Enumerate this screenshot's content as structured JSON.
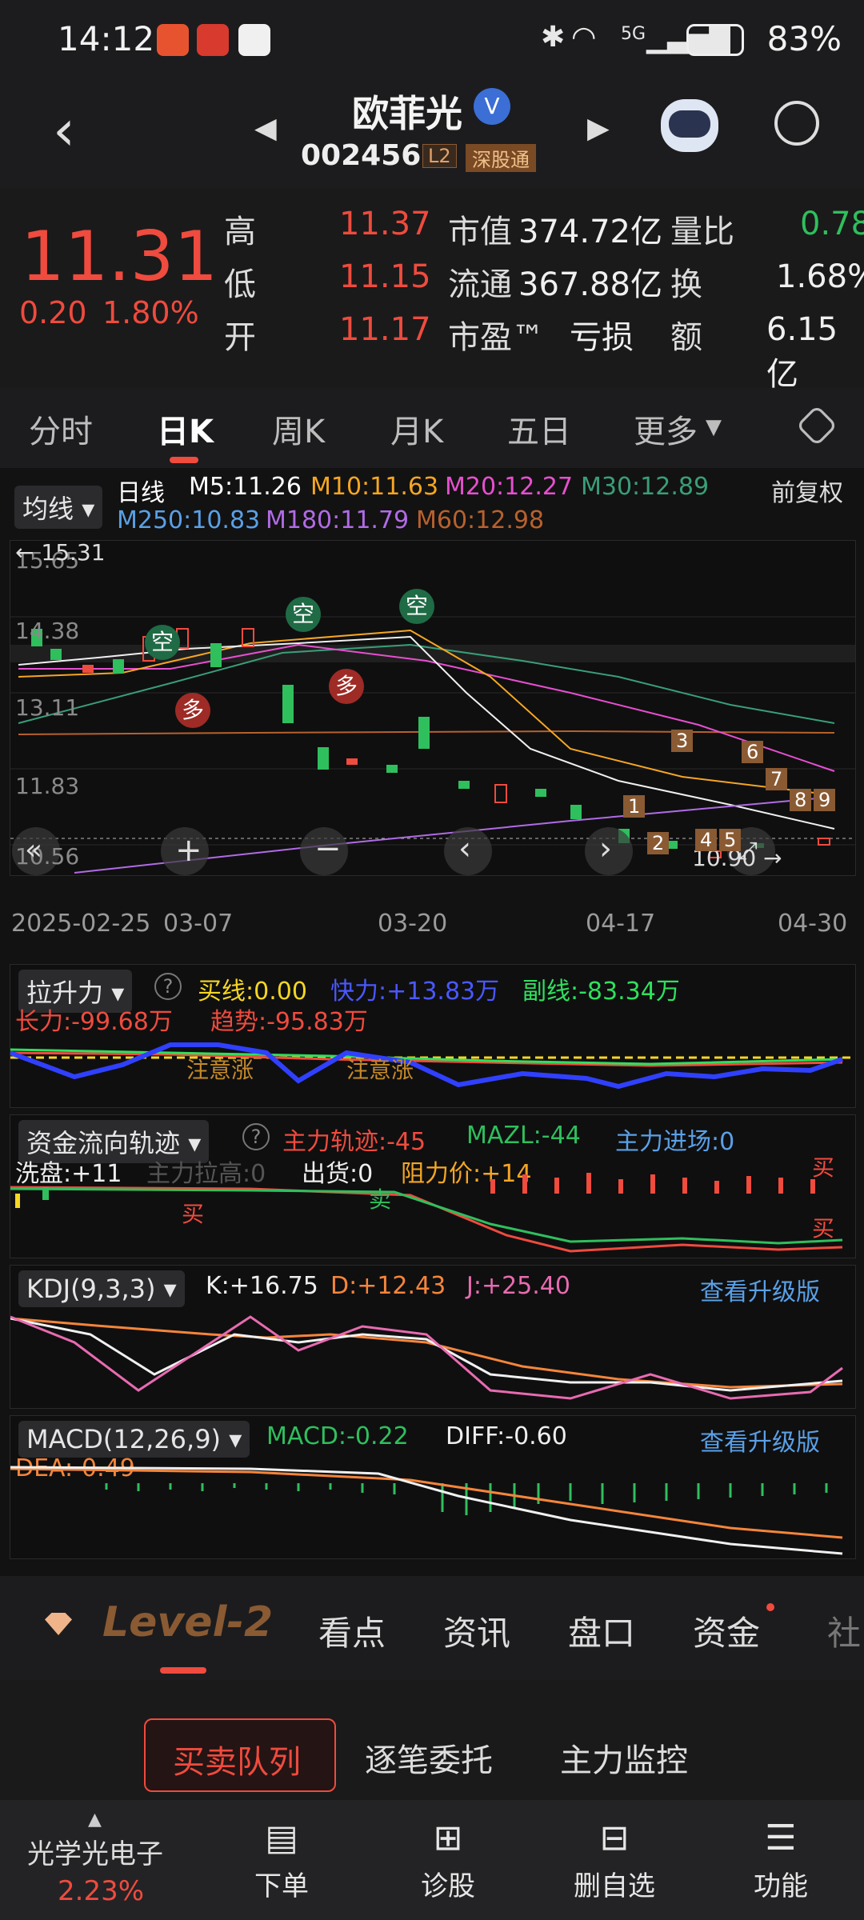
{
  "status_bar": {
    "time": "14:12",
    "battery": "83%",
    "network": "5G"
  },
  "header": {
    "stock_name": "欧菲光",
    "stock_code": "002456",
    "badge_l2": "L2",
    "badge_market": "深股通",
    "verified_mark": "V"
  },
  "quote": {
    "price": "11.31",
    "change": "0.20",
    "change_pct": "1.80%",
    "rows": [
      {
        "l1": "高",
        "v1": "11.37",
        "l2": "市值",
        "v2": "374.72亿",
        "l3": "量比",
        "v3": "0.78"
      },
      {
        "l1": "低",
        "v1": "11.15",
        "l2": "流通",
        "v2": "367.88亿",
        "l3": "换",
        "v3": "1.68%"
      },
      {
        "l1": "开",
        "v1": "11.17",
        "l2": "市盈™",
        "v2": "亏损",
        "l3": "额",
        "v3": "6.15亿"
      }
    ]
  },
  "period_tabs": [
    "分时",
    "日K",
    "周K",
    "月K",
    "五日",
    "更多"
  ],
  "active_period": "日K",
  "ma_header": {
    "selector": "均线",
    "type": "日线",
    "m5": "M5:11.26",
    "m10": "M10:11.63",
    "m20": "M20:12.27",
    "m30": "M30:12.89",
    "m250": "M250:10.83",
    "m180": "M180:11.79",
    "m60": "M60:12.98",
    "adjust": "前复权"
  },
  "kline": {
    "y_labels": [
      "15.65",
      "14.38",
      "13.11",
      "11.83",
      "10.56"
    ],
    "high_marker": "15.31",
    "low_marker": "10.90",
    "date_labels": [
      "2025-02-25",
      "03-07",
      "03-20",
      "04-17",
      "04-30"
    ],
    "signals_empty": [
      "空",
      "空",
      "空"
    ],
    "signals_more": [
      "多",
      "多"
    ],
    "counts": [
      "1",
      "2",
      "3",
      "4",
      "5",
      "6",
      "7",
      "8",
      "9"
    ]
  },
  "chart_data": {
    "type": "candlestick",
    "x": [
      "2025-02-25",
      "2025-03-07",
      "2025-03-20",
      "2025-04-17",
      "2025-04-30"
    ],
    "ylim": [
      10.56,
      15.65
    ],
    "last_close": 11.31
  },
  "lsl": {
    "selector": "拉升力",
    "buy": "买线:0.00",
    "fast": "快力:+13.83万",
    "sub": "副线:-83.34万",
    "long": "长力:-99.68万",
    "trend": "趋势:-95.83万",
    "note1": "注意涨",
    "note2": "注意涨"
  },
  "fund": {
    "selector": "资金流向轨迹",
    "main": "主力轨迹:-45",
    "mazl": "MAZL:-44",
    "enter": "主力进场:0",
    "wash": "洗盘:+11",
    "pull": "主力拉高:0",
    "ship": "出货:0",
    "resist": "阻力价:+14",
    "buy1": "买",
    "sell1": "卖",
    "buy2": "买",
    "sell2": "买"
  },
  "kdj": {
    "selector": "KDJ(9,3,3)",
    "k": "K:+16.75",
    "d": "D:+12.43",
    "j": "J:+25.40",
    "upgrade": "查看升级版"
  },
  "macd": {
    "selector": "MACD(12,26,9)",
    "macd": "MACD:-0.22",
    "diff": "DIFF:-0.60",
    "dea": "DEA:-0.49",
    "upgrade": "查看升级版"
  },
  "bottom_tabs": [
    "Level-2",
    "看点",
    "资讯",
    "盘口",
    "资金",
    "社"
  ],
  "sub_tabs": [
    "买卖队列",
    "逐笔委托",
    "主力监控"
  ],
  "nav": {
    "sector_name": "光学光电子",
    "sector_pct": "2.23%",
    "items": [
      "下单",
      "诊股",
      "删自选",
      "功能"
    ]
  },
  "colors": {
    "red": "#ef4b3e",
    "green": "#2fbf5d",
    "white": "#f0f0f0",
    "orange": "#f5a623",
    "magenta": "#e84fd0",
    "teal": "#3a9e78",
    "blue": "#5aa0e6",
    "purple": "#b16be6",
    "brown": "#b7612e"
  }
}
